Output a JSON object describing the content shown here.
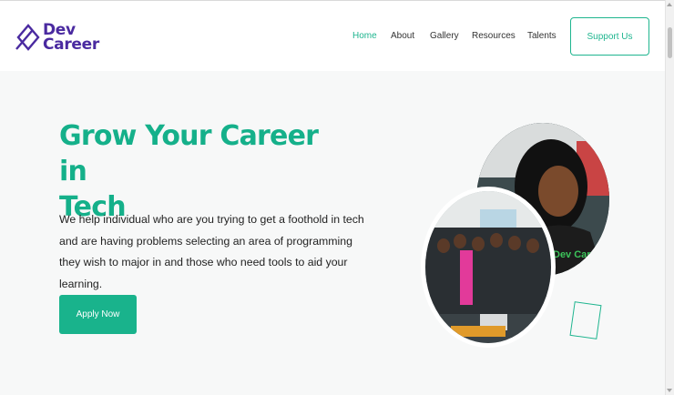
{
  "brand": {
    "line1": "Dev",
    "line2": "Career",
    "color": "#4a2aa0"
  },
  "nav": {
    "items": [
      {
        "label": "Home",
        "active": true
      },
      {
        "label": "About",
        "active": false
      },
      {
        "label": "Gallery",
        "active": false
      },
      {
        "label": "Resources",
        "active": false
      },
      {
        "label": "Talents",
        "active": false
      }
    ],
    "cta": "Support Us"
  },
  "hero": {
    "title_line1": "Grow Your Career in",
    "title_line2": "Tech",
    "description": "We help individual who are you trying to get a foothold in tech and are having problems selecting an area of programming they wish to major in and those who need tools to aid your learning.",
    "button": "Apply Now"
  },
  "photos": {
    "portrait_shirt_text": "Dev Career",
    "group_icon": "group-photo"
  },
  "colors": {
    "accent": "#1fb58f",
    "accent_dark": "#15b08a",
    "text": "#222222"
  }
}
